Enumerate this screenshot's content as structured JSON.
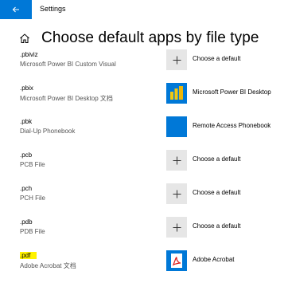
{
  "window": {
    "title": "Settings"
  },
  "page": {
    "title": "Choose default apps by file type"
  },
  "rows": [
    {
      "ext": ".pbiviz",
      "desc": "Microsoft Power BI Custom Visual",
      "app": "Choose a default",
      "icon": "plus-icon"
    },
    {
      "ext": ".pbix",
      "desc": "Microsoft Power BI Desktop 文档",
      "app": "Microsoft Power BI Desktop",
      "icon": "power-bi-icon"
    },
    {
      "ext": ".pbk",
      "desc": "Dial-Up Phonebook",
      "app": "Remote Access Phonebook",
      "icon": "remote-access-phonebook-icon"
    },
    {
      "ext": ".pcb",
      "desc": "PCB File",
      "app": "Choose a default",
      "icon": "plus-icon"
    },
    {
      "ext": ".pch",
      "desc": "PCH File",
      "app": "Choose a default",
      "icon": "plus-icon"
    },
    {
      "ext": ".pdb",
      "desc": "PDB File",
      "app": "Choose a default",
      "icon": "plus-icon"
    },
    {
      "ext": ".pdf",
      "desc": "Adobe Acrobat 文档",
      "app": "Adobe Acrobat",
      "icon": "adobe-acrobat-icon",
      "highlighted": true
    }
  ],
  "colors": {
    "accent": "#0078d7",
    "highlight": "#fff200",
    "tile_gray": "#e6e6e6",
    "acrobat_red": "#e0201e"
  }
}
